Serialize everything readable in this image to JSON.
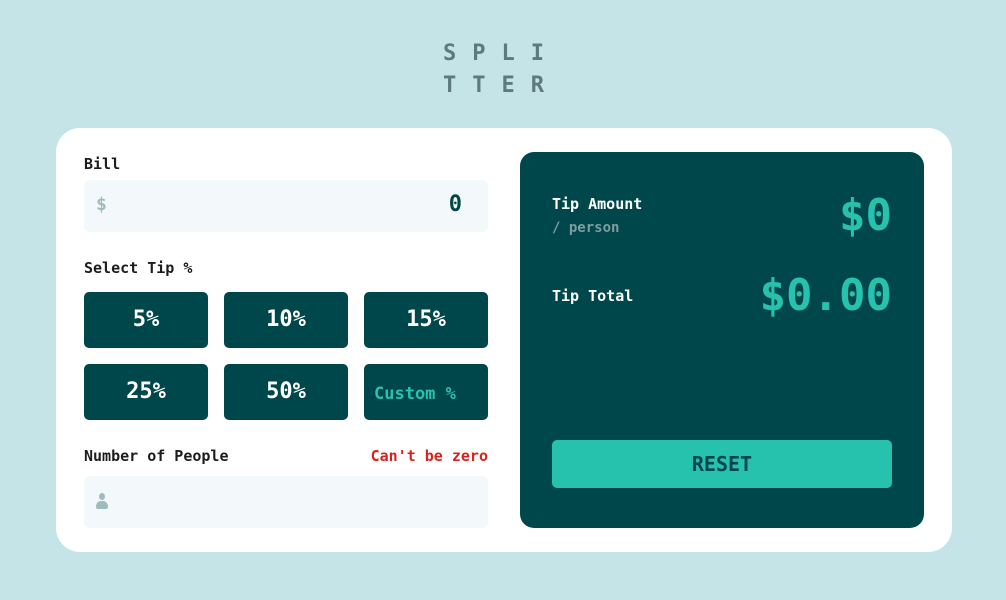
{
  "logo": {
    "line1": "SPLI",
    "line2": "TTER"
  },
  "bill": {
    "label": "Bill",
    "currency_symbol": "$",
    "value": "0"
  },
  "tip": {
    "label": "Select Tip %",
    "options": [
      "5%",
      "10%",
      "15%",
      "25%",
      "50%"
    ],
    "custom_placeholder": "Custom %"
  },
  "people": {
    "label": "Number of People",
    "error": "Can't be zero",
    "value": ""
  },
  "results": {
    "tip_amount_label": "Tip Amount",
    "tip_amount_sub": "/ person",
    "tip_amount_value": "$0",
    "tip_total_label": "Tip Total",
    "tip_total_value": "$0.00",
    "reset_label": "RESET"
  },
  "colors": {
    "background": "#c5e4e7",
    "dark_cyan": "#00474b",
    "accent": "#26c2ae",
    "error": "#d7231c",
    "input_bg": "#f3f9fa"
  },
  "icons": {
    "bill_input": "dollar-icon",
    "people_input": "person-icon"
  }
}
